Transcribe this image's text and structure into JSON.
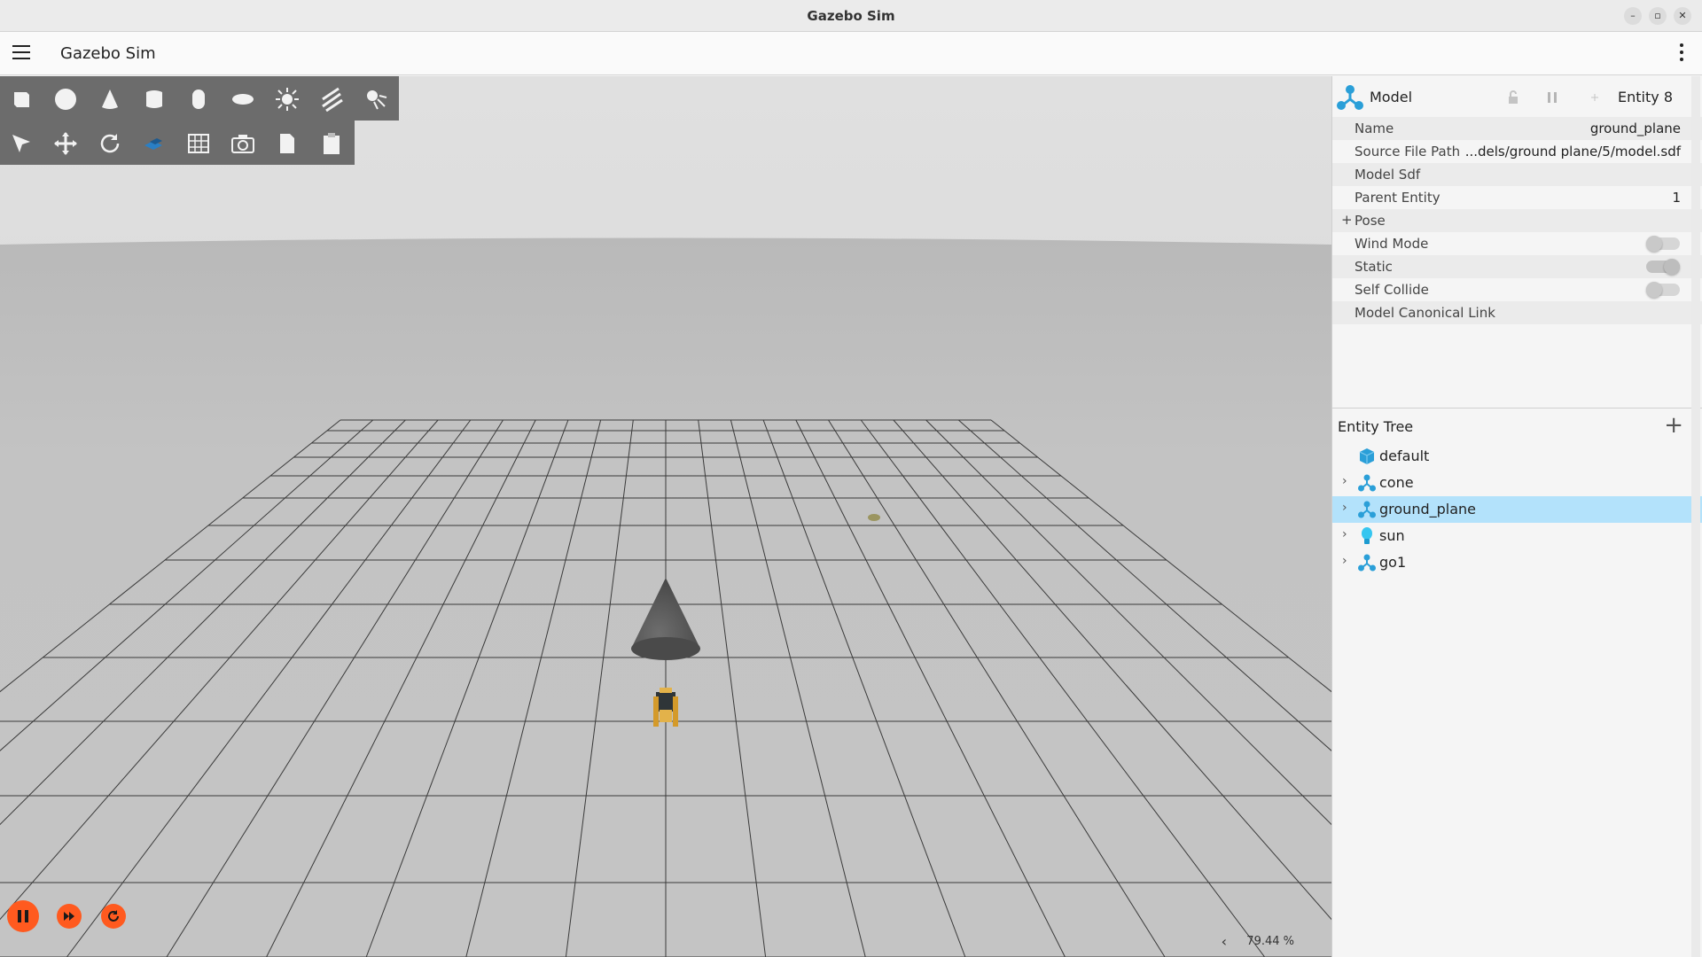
{
  "window": {
    "title": "Gazebo Sim",
    "buttons": [
      "–",
      "▫",
      "✕"
    ]
  },
  "appbar": {
    "title": "Gazebo Sim"
  },
  "toolbar": {
    "shapes": [
      "box-icon",
      "sphere-icon",
      "cone-icon",
      "cylinder-icon",
      "capsule-icon",
      "ellipsoid-icon",
      "sun-light-icon",
      "directional-light-icon",
      "spot-light-icon"
    ],
    "transforms": [
      "select-arrow-icon",
      "translate-icon",
      "rotate-icon",
      "snap-icon",
      "grid-icon",
      "screenshot-icon",
      "copy-icon",
      "paste-icon"
    ]
  },
  "status": {
    "rtf": "79.44 %",
    "collapse": "‹"
  },
  "component": {
    "type": "Model",
    "entity": "Entity 8",
    "rows": [
      {
        "key": "Name",
        "value": "ground_plane"
      },
      {
        "key": "Source File Path",
        "value": "...dels/ground plane/5/model.sdf"
      },
      {
        "key": "Model Sdf",
        "value": ""
      },
      {
        "key": "Parent Entity",
        "value": "1"
      },
      {
        "key": "Pose",
        "value": ""
      },
      {
        "key": "Wind Mode",
        "value": ""
      },
      {
        "key": "Static",
        "value": ""
      },
      {
        "key": "Self Collide",
        "value": ""
      },
      {
        "key": "Model Canonical Link",
        "value": ""
      }
    ],
    "pose_expander": "+",
    "toggles": {
      "wind_mode": false,
      "static": true,
      "self_collide": false
    }
  },
  "entity_tree": {
    "title": "Entity Tree",
    "add": "+",
    "items": [
      {
        "name": "default",
        "icon": "world-cube-icon",
        "expandable": false,
        "selected": false
      },
      {
        "name": "cone",
        "icon": "model-icon",
        "expandable": true,
        "selected": false
      },
      {
        "name": "ground_plane",
        "icon": "model-icon",
        "expandable": true,
        "selected": true
      },
      {
        "name": "sun",
        "icon": "light-bulb-icon",
        "expandable": true,
        "selected": false
      },
      {
        "name": "go1",
        "icon": "model-icon",
        "expandable": true,
        "selected": false
      }
    ]
  },
  "colors": {
    "accent_play": "#ff5a1f",
    "selection": "#b3e2fb",
    "toolbar": "#6c6c6c",
    "model_icon": "#2a9fd8"
  }
}
